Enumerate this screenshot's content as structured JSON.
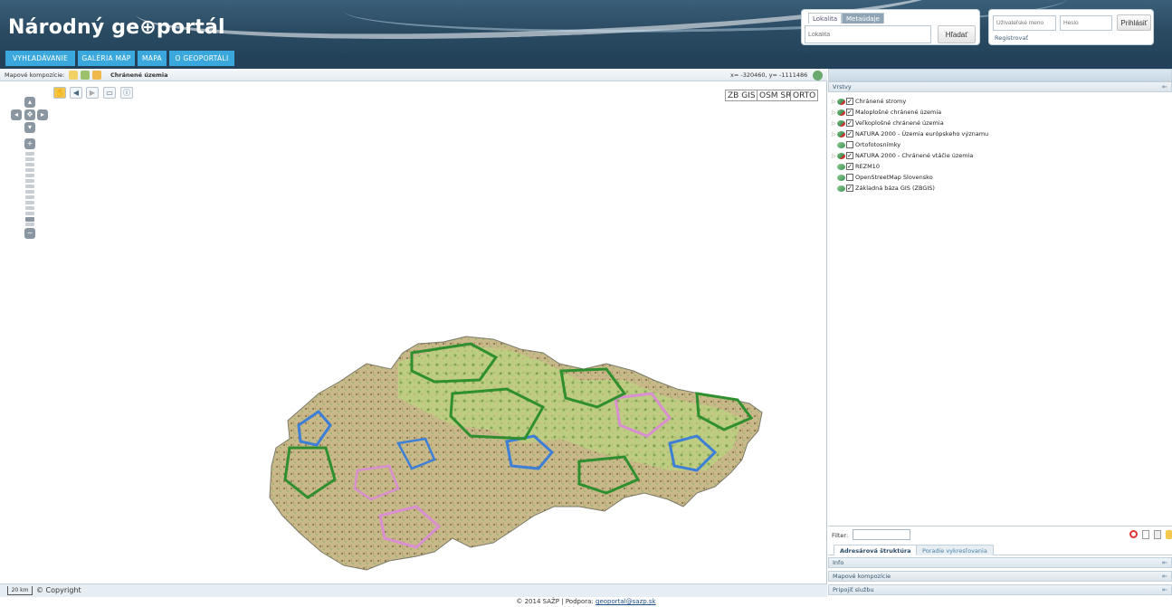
{
  "header": {
    "logo_text": "Národný ge⊕portál",
    "search": {
      "tab_locality": "Lokalita",
      "tab_metadata": "Metaúdaje",
      "placeholder": "Lokalita",
      "button": "Hľadať"
    },
    "login": {
      "username_placeholder": "Užívateľské meno",
      "password_placeholder": "Heslo",
      "button": "Prihlásiť",
      "register": "Registrovať"
    }
  },
  "nav": {
    "tabs": [
      "VYHĽADÁVANIE",
      "GALÉRIA MÁP",
      "MAPA",
      "O GEOPORTÁLI"
    ]
  },
  "map": {
    "composition_label": "Mapové kompozície:",
    "composition_name": "Chránené územia",
    "coordinates": "x= -320460, y= -1111486",
    "basemaps": [
      "ZB GIS",
      "OSM SR",
      "ORTO"
    ],
    "scale": "20 km",
    "copyright": "© Copyright"
  },
  "right_panel": {
    "layers_title": "Vrstvy",
    "layers": [
      {
        "name": "Chránené stromy",
        "checked": true,
        "expandable": true
      },
      {
        "name": "Maloplošné chránené územia",
        "checked": true,
        "expandable": true
      },
      {
        "name": "Veľkoplošné chránené územia",
        "checked": true,
        "expandable": true
      },
      {
        "name": "NATURA 2000 - Územia európskeho významu",
        "checked": true,
        "expandable": true
      },
      {
        "name": "Ortofotosnímky",
        "checked": false,
        "expandable": false
      },
      {
        "name": "NATURA 2000 - Chránené vtáčie územia",
        "checked": true,
        "expandable": true
      },
      {
        "name": "REZM10",
        "checked": true,
        "expandable": false
      },
      {
        "name": "OpenStreetMap Slovensko",
        "checked": false,
        "expandable": false
      },
      {
        "name": "Základná báza GIS (ZBGIS)",
        "checked": true,
        "expandable": false
      }
    ],
    "filter_label": "Filter:",
    "tabs": [
      "Adresárová štruktúra",
      "Poradie vykresľovania"
    ],
    "sections": [
      "Info",
      "Mapové kompozície",
      "Pripojiť službu"
    ]
  },
  "footer": {
    "text": "© 2014 SAŽP | Podpora: ",
    "email": "geoportal@sazp.sk"
  },
  "colors": {
    "header_bg": "#2b4b63",
    "nav_tab": "#3aa7dd",
    "map_green": "#2f8f2f",
    "map_blue": "#3d7fd6",
    "map_pink": "#d98fd0"
  }
}
